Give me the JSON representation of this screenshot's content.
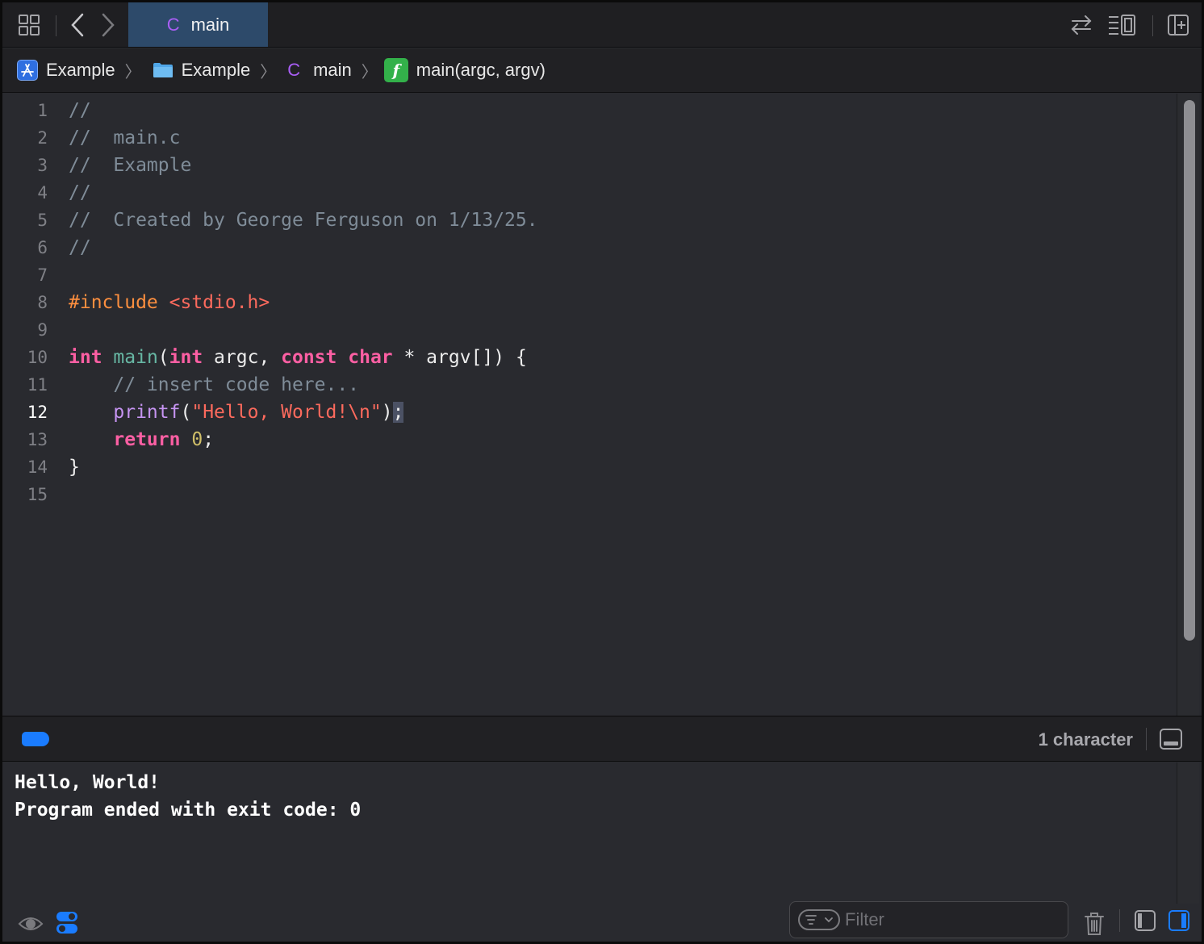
{
  "tabbar": {
    "active_tab": {
      "icon": "c-file-icon",
      "icon_glyph": "C",
      "label": "main"
    },
    "right_icons": [
      "swap-arrows-icon",
      "list-inspector-icon",
      "add-editor-icon"
    ],
    "left_icons": [
      "grid-icon",
      "chevron-left-icon",
      "chevron-right-icon"
    ]
  },
  "breadcrumb": {
    "items": [
      {
        "icon": "app-project-icon",
        "label": "Example"
      },
      {
        "icon": "folder-icon",
        "label": "Example"
      },
      {
        "icon": "c-file-icon",
        "icon_glyph": "C",
        "label": "main"
      },
      {
        "icon": "function-icon",
        "icon_glyph": "f",
        "label": "main(argc, argv)"
      }
    ],
    "separator": "〉"
  },
  "editor": {
    "current_line": 12,
    "line_numbers": [
      "1",
      "2",
      "3",
      "4",
      "5",
      "6",
      "7",
      "8",
      "9",
      "10",
      "11",
      "12",
      "13",
      "14",
      "15"
    ],
    "lines": [
      [
        {
          "t": "//",
          "c": "cmt"
        }
      ],
      [
        {
          "t": "//  main.c",
          "c": "cmt"
        }
      ],
      [
        {
          "t": "//  Example",
          "c": "cmt"
        }
      ],
      [
        {
          "t": "//",
          "c": "cmt"
        }
      ],
      [
        {
          "t": "//  Created by George Ferguson on 1/13/25.",
          "c": "cmt"
        }
      ],
      [
        {
          "t": "//",
          "c": "cmt"
        }
      ],
      [],
      [
        {
          "t": "#include ",
          "c": "pre"
        },
        {
          "t": "<stdio.h>",
          "c": "str"
        }
      ],
      [],
      [
        {
          "t": "int",
          "c": "kw"
        },
        {
          "t": " ",
          "c": "plain"
        },
        {
          "t": "main",
          "c": "fn"
        },
        {
          "t": "(",
          "c": "plain"
        },
        {
          "t": "int",
          "c": "kw"
        },
        {
          "t": " argc, ",
          "c": "plain"
        },
        {
          "t": "const",
          "c": "kw"
        },
        {
          "t": " ",
          "c": "plain"
        },
        {
          "t": "char",
          "c": "kw"
        },
        {
          "t": " * argv[]) {",
          "c": "plain"
        }
      ],
      [
        {
          "t": "    // insert code here...",
          "c": "cmt"
        }
      ],
      [
        {
          "t": "    ",
          "c": "plain"
        },
        {
          "t": "printf",
          "c": "call"
        },
        {
          "t": "(",
          "c": "plain"
        },
        {
          "t": "\"Hello, World!\\n\"",
          "c": "str"
        },
        {
          "t": ")",
          "c": "plain"
        },
        {
          "t": ";",
          "c": "plain sel"
        }
      ],
      [
        {
          "t": "    ",
          "c": "plain"
        },
        {
          "t": "return",
          "c": "kw"
        },
        {
          "t": " ",
          "c": "plain"
        },
        {
          "t": "0",
          "c": "num"
        },
        {
          "t": ";",
          "c": "plain"
        }
      ],
      [
        {
          "t": "}",
          "c": "plain"
        }
      ],
      []
    ]
  },
  "debugbar": {
    "breakpoint_color": "#1a7cff",
    "selection_status": "1 character"
  },
  "console": {
    "output_lines": [
      "Hello, World!",
      "Program ended with exit code: 0"
    ],
    "filter_placeholder": "Filter"
  },
  "colors": {
    "accent": "#1a7cff",
    "active_tab": "#2d4a6a",
    "editor_bg": "#292a2f"
  }
}
